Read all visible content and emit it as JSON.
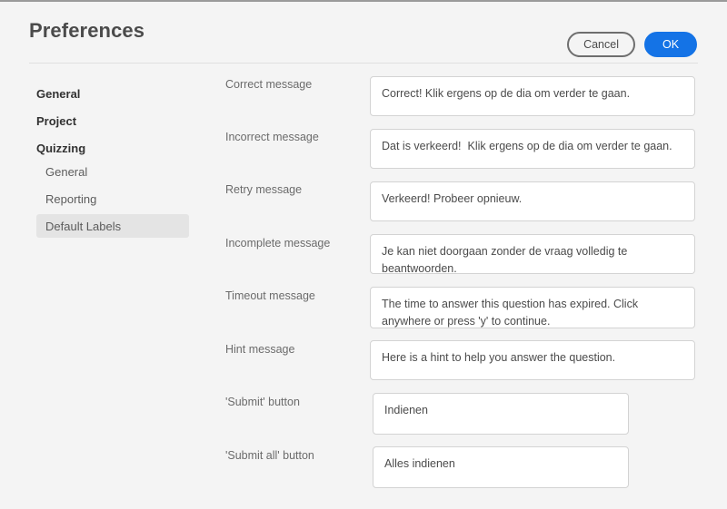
{
  "header": {
    "title": "Preferences",
    "cancel_label": "Cancel",
    "ok_label": "OK",
    "accent_color": "#1473e6"
  },
  "sidebar": {
    "items": [
      {
        "label": "General",
        "level": 0,
        "selected": false
      },
      {
        "label": "Project",
        "level": 0,
        "selected": false
      },
      {
        "label": "Quizzing",
        "level": 0,
        "selected": false
      },
      {
        "label": "General",
        "level": 1,
        "selected": false
      },
      {
        "label": "Reporting",
        "level": 1,
        "selected": false
      },
      {
        "label": "Default Labels",
        "level": 1,
        "selected": true
      }
    ]
  },
  "form": {
    "fields": [
      {
        "label": "Correct message",
        "value": "Correct! Klik ergens op de dia om verder te gaan."
      },
      {
        "label": "Incorrect message",
        "value": "Dat is verkeerd!  Klik ergens op de dia om verder te gaan."
      },
      {
        "label": "Retry message",
        "value": "Verkeerd! Probeer opnieuw."
      },
      {
        "label": "Incomplete message",
        "value": "Je kan niet doorgaan zonder de vraag volledig te beantwoorden."
      },
      {
        "label": "Timeout message",
        "value": "The time to answer this question has expired. Click anywhere or press 'y' to continue."
      },
      {
        "label": "Hint message",
        "value": "Here is a hint to help you answer the question."
      },
      {
        "label": "'Submit' button",
        "value": "Indienen"
      },
      {
        "label": "'Submit all' button",
        "value": "Alles indienen"
      }
    ]
  }
}
